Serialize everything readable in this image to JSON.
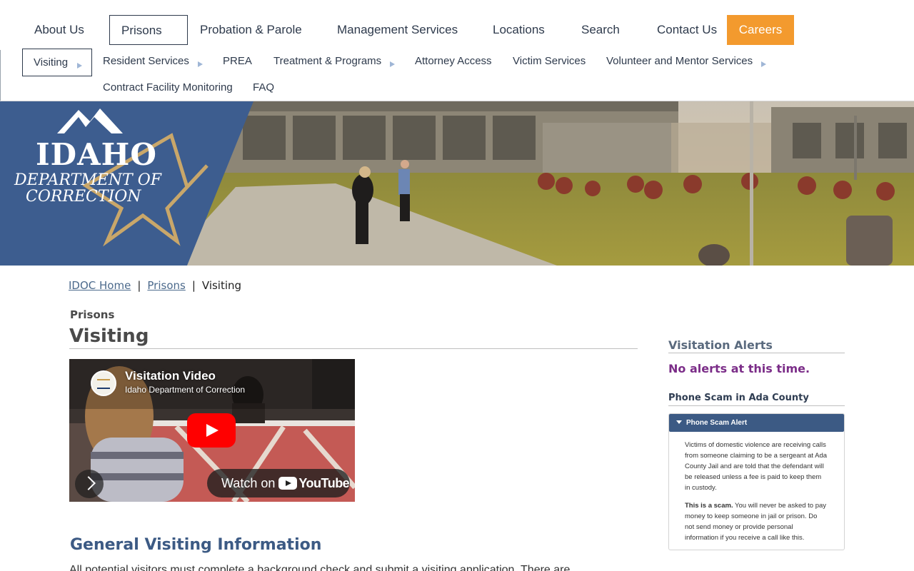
{
  "topnav": {
    "about": "About Us",
    "prisons": "Prisons",
    "probation": "Probation & Parole",
    "management": "Management Services",
    "locations": "Locations",
    "search": "Search",
    "contact": "Contact Us",
    "careers": "Careers"
  },
  "subnav": {
    "visiting": "Visiting",
    "resident": "Resident Services",
    "prea": "PREA",
    "treatment": "Treatment & Programs",
    "attorney": "Attorney Access",
    "victim": "Victim Services",
    "volunteer": "Volunteer and Mentor Services",
    "contract": "Contract Facility Monitoring",
    "faq": "FAQ"
  },
  "banner": {
    "logo_line1": "IDAHO",
    "logo_line2": "DEPARTMENT OF",
    "logo_line3": "CORRECTION"
  },
  "breadcrumb": {
    "home": "IDOC Home",
    "sep": "|",
    "prisons": "Prisons",
    "current": "Visiting"
  },
  "main": {
    "kicker": "Prisons",
    "title": "Visiting",
    "video": {
      "title": "Visitation Video",
      "channel": "Idaho Department of Correction",
      "watch_on": "Watch on",
      "youtube": "YouTube"
    },
    "h2": "General Visiting Information",
    "intro": "All potential visitors must complete a background check and submit a visiting application. There are"
  },
  "sidebar": {
    "alerts_heading": "Visitation Alerts",
    "no_alerts": "No alerts at this time.",
    "scam_heading": "Phone Scam in Ada County",
    "accordion_title": "Phone Scam Alert",
    "para1": "Victims of domestic violence are receiving calls from someone claiming to be a sergeant at Ada County Jail and are told that the defendant will be released unless a fee is paid to keep them in custody.",
    "para2_bold": "This is a scam.",
    "para2_rest": " You will never be asked to pay money to keep someone in jail or prison. Do not send money or provide personal information if you receive a call like this."
  },
  "colors": {
    "brand_blue": "#3c5a84",
    "careers_orange": "#f39a2e",
    "alert_purple": "#7b2d88",
    "star_gold": "#c9a76a"
  }
}
